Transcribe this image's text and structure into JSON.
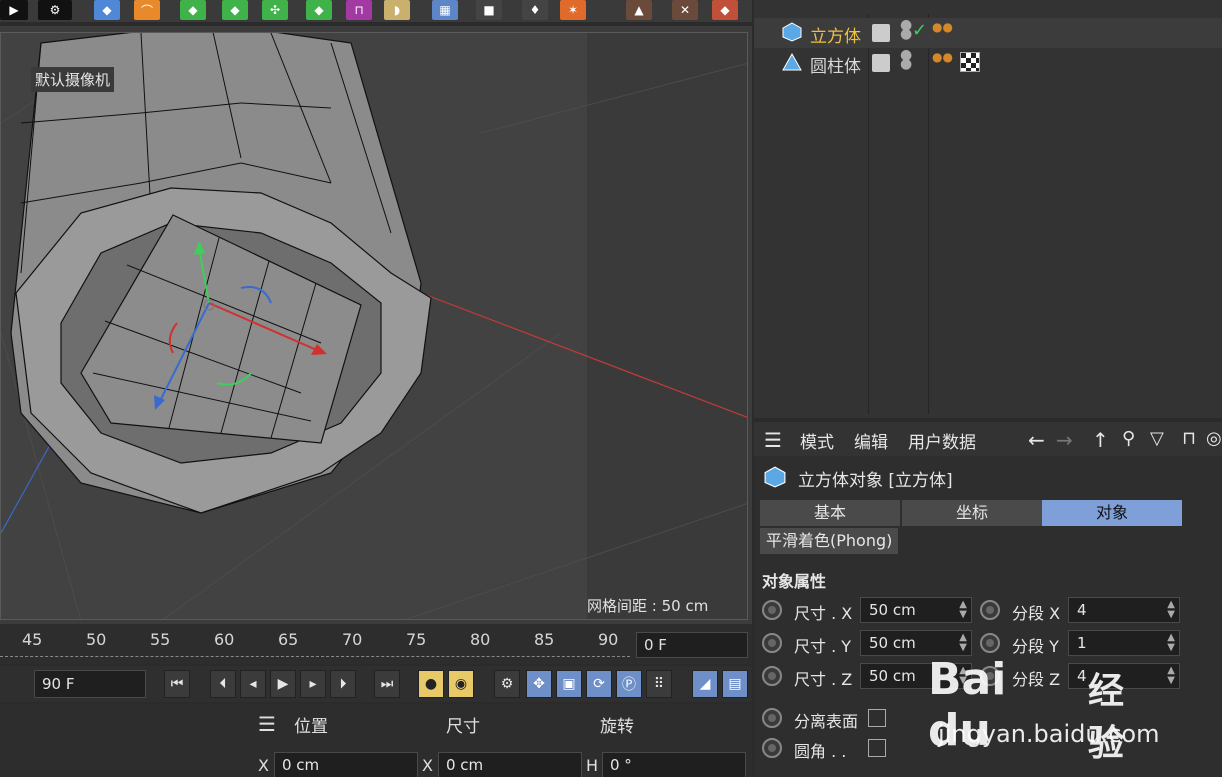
{
  "viewport": {
    "camera_label": "默认摄像机",
    "grid_spacing": "网格间距 : 50 cm"
  },
  "timeline": {
    "ticks": [
      "45",
      "50",
      "55",
      "60",
      "65",
      "70",
      "75",
      "80",
      "85",
      "90"
    ],
    "current_frame": "0 F"
  },
  "transport": {
    "end_frame": "90 F"
  },
  "coords": {
    "position_label": "位置",
    "size_label": "尺寸",
    "rotation_label": "旋转",
    "x_position": "0 cm",
    "x_size": "0 cm",
    "h_rotation": "0 °",
    "axis_x": "X",
    "axis_h": "H"
  },
  "objects": [
    {
      "name": "立方体",
      "color": "#f0c040"
    },
    {
      "name": "圆柱体",
      "color": "#e6e6e6"
    }
  ],
  "attrs": {
    "menu": [
      "模式",
      "编辑",
      "用户数据"
    ],
    "title": "立方体对象 [立方体]",
    "tabs": [
      "基本",
      "坐标",
      "对象"
    ],
    "active_tab": "对象",
    "phong": "平滑着色(Phong)",
    "section": "对象属性",
    "size_x_label": "尺寸 . X",
    "size_x": "50 cm",
    "size_y_label": "尺寸 . Y",
    "size_y": "50 cm",
    "size_z_label": "尺寸 . Z",
    "size_z": "50 cm",
    "seg_x_label": "分段 X",
    "seg_x": "4",
    "seg_y_label": "分段 Y",
    "seg_y": "1",
    "seg_z_label": "分段 Z",
    "seg_z": "4",
    "separate_surfaces": "分离表面",
    "fillet": "圆角 . ."
  },
  "watermark": {
    "brand": "Bai du",
    "jingyan": "经验",
    "url": "jingyan.baidu.com"
  },
  "colors": {
    "accent": "#7f9fd8",
    "selected_object": "#f0c040",
    "axis_red": "#d03030"
  }
}
